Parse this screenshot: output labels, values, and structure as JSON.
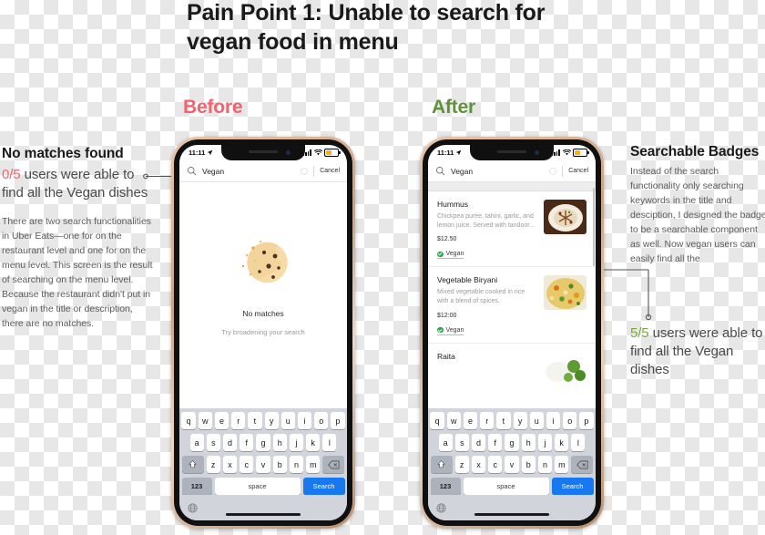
{
  "headline": "Pain Point 1: Unable to search for vegan food in menu",
  "comparison": {
    "before_label": "Before",
    "after_label": "After",
    "before_color": "#f4636b",
    "after_color": "#5f9238"
  },
  "left_annotation": {
    "title": "No matches found",
    "stat_fraction": "0/5",
    "stat_rest": " users were able to find all the Vegan dishes",
    "paragraph": "There are two search functionalities in Uber Eats—one for on the restaurant level and one for on the menu level. This screen is the result of searching on the menu level. Because the restaurant didn't put in vegan in the title or description, there are no matches."
  },
  "right_annotation": {
    "title": "Searchable Badges",
    "paragraph": "Instead of the search functionality only searching keywords in the title and desciption, I designed the badge to be a searchable component as well. Now vegan users can easily find all the",
    "stat_fraction": "5/5",
    "stat_rest": " users were able to find all the Vegan dishes"
  },
  "phone_before": {
    "status_bar": {
      "time": "11:11",
      "location_icon": "location-arrow-icon",
      "signal_icon": "cellular-bars-icon",
      "wifi_icon": "wifi-icon",
      "battery_icon": "battery-icon"
    },
    "search": {
      "value": "Vegan",
      "search_icon": "search-icon",
      "clear_icon": "clear-circle-icon",
      "cancel_label": "Cancel"
    },
    "empty_state": {
      "illustration": "cookie-icon",
      "title": "No matches",
      "subtitle": "Try broadening your search"
    }
  },
  "phone_after": {
    "status_bar": {
      "time": "11:11",
      "location_icon": "location-arrow-icon",
      "signal_icon": "cellular-bars-icon",
      "wifi_icon": "wifi-icon",
      "battery_icon": "battery-icon"
    },
    "search": {
      "value": "Vegan",
      "search_icon": "search-icon",
      "clear_icon": "clear-circle-icon",
      "cancel_label": "Cancel"
    },
    "dishes": [
      {
        "name": "Hummus",
        "description": "Chickpea puree, tahini, garlic, and lemon juice. Served with tandoor...",
        "price": "$12.50",
        "badge": "Vegan"
      },
      {
        "name": "Vegetable Biryani",
        "description": "Mixed vegetable cooked in rice with a blend of spices.",
        "price": "$12:00",
        "badge": "Vegan"
      },
      {
        "name": "Raita",
        "description": "",
        "price": "",
        "badge": ""
      }
    ],
    "badge_color": "#2aa34a"
  },
  "keyboard": {
    "row1": [
      "q",
      "w",
      "e",
      "r",
      "t",
      "y",
      "u",
      "i",
      "o",
      "p"
    ],
    "row2": [
      "a",
      "s",
      "d",
      "f",
      "g",
      "h",
      "j",
      "k",
      "l"
    ],
    "row3": [
      "z",
      "x",
      "c",
      "v",
      "b",
      "n",
      "m"
    ],
    "shift_icon": "shift-icon",
    "backspace_icon": "backspace-icon",
    "numbers_label": "123",
    "space_label": "space",
    "search_label": "Search",
    "globe_icon": "globe-icon"
  }
}
